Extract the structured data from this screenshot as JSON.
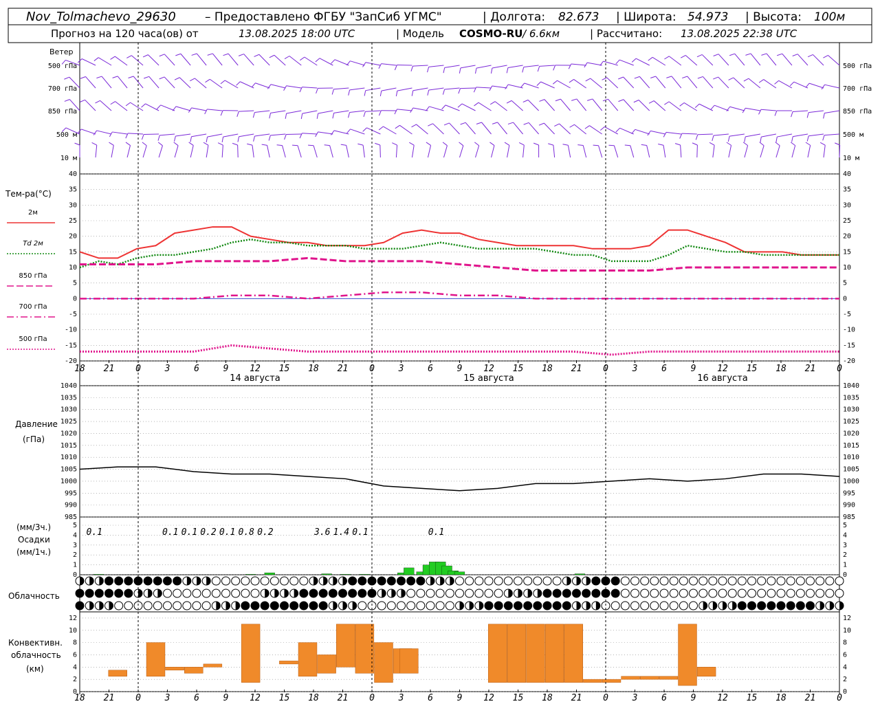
{
  "header": {
    "station": "Nov_Tolmachevo_29630",
    "provider": "– Предоставлено ФГБУ \"ЗапСиб УГМС\"",
    "lon_label": "| Долгота:",
    "lon_value": "82.673",
    "lat_label": "| Широта:",
    "lat_value": "54.973",
    "alt_label": "| Высота:",
    "alt_value": "100м",
    "forecast_label": "Прогноз на 120 часа(ов) от",
    "forecast_start": "13.08.2025 18:00 UTC",
    "model_label": "| Модель",
    "model_name": "COSMO-RU",
    "model_res": "/ 6.6км",
    "calc_label": "| Рассчитано:",
    "calc_time": "13.08.2025 22:38 UTC"
  },
  "wind_panel": {
    "title": "Ветер",
    "levels": [
      "500 гПа",
      "700 гПа",
      "850 гПа",
      "500 м",
      "10  м"
    ],
    "barb_color": "#7a28d8"
  },
  "temp_panel": {
    "title": "Тем-ра(°С)",
    "legend": [
      {
        "label": "2м",
        "color": "#ee3333",
        "style": "solid"
      },
      {
        "label": "Td  2м",
        "color": "#118811",
        "style": "dotted"
      },
      {
        "label": "850 гПа",
        "color": "#e0148c",
        "style": "dashed"
      },
      {
        "label": "700 гПа",
        "color": "#e0148c",
        "style": "dashdot"
      },
      {
        "label": "500 гПа",
        "color": "#e0148c",
        "style": "dotted"
      }
    ],
    "y_ticks": [
      "40",
      "35",
      "30",
      "25",
      "20",
      "15",
      "10",
      "5",
      "0",
      "-5",
      "-10",
      "-15",
      "-20"
    ]
  },
  "x_axis": {
    "hour_labels": [
      "18",
      "21",
      "0",
      "3",
      "6",
      "9",
      "12",
      "15",
      "18",
      "21",
      "0",
      "3",
      "6",
      "9",
      "12",
      "15",
      "18",
      "21",
      "0",
      "3",
      "6",
      "9",
      "12",
      "15",
      "18",
      "21",
      "0"
    ],
    "day_labels": [
      "14 августа",
      "15 августа",
      "16 августа"
    ]
  },
  "pressure_panel": {
    "title_line1": "Давление",
    "title_line2": "(гПа)",
    "y_ticks": [
      "1040",
      "1035",
      "1030",
      "1025",
      "1020",
      "1015",
      "1010",
      "1005",
      "1000",
      "995",
      "990",
      "985"
    ]
  },
  "precip_panel": {
    "label_3h": "(мм/3ч.)",
    "title": "Осадки",
    "label_1h": "(мм/1ч.)",
    "y_ticks": [
      "5",
      "4",
      "3",
      "2",
      "1",
      "0"
    ],
    "color": "#22cc22",
    "totals_3h": [
      {
        "hour": 0,
        "text": "0.1"
      },
      {
        "hour": 12,
        "text": "0.1"
      },
      {
        "hour": 15,
        "text": "0.1"
      },
      {
        "hour": 18,
        "text": "0.2"
      },
      {
        "hour": 21,
        "text": "0.1"
      },
      {
        "hour": 24,
        "text": "0.8"
      },
      {
        "hour": 27,
        "text": "0.2"
      },
      {
        "hour": 36,
        "text": "3.6"
      },
      {
        "hour": 39,
        "text": "1.4"
      },
      {
        "hour": 42,
        "text": "0.1"
      },
      {
        "hour": 54,
        "text": "0.1"
      }
    ]
  },
  "cloud_panel": {
    "title": "Облачность"
  },
  "conv_panel": {
    "title_line1": "Конвективн.",
    "title_line2": "облачность",
    "title_line3": "(км)",
    "y_ticks": [
      "12",
      "10",
      "8",
      "6",
      "4",
      "2",
      "0"
    ],
    "color": "#f08a2a"
  },
  "chart_data": [
    {
      "type": "line",
      "title": "Тем-ра(°С)",
      "x_unit": "hours from 13.08.2025 18:00 UTC",
      "ylim": [
        -20,
        40
      ],
      "series": [
        {
          "name": "2м",
          "x": [
            0,
            3,
            6,
            9,
            12,
            15,
            18,
            21,
            24,
            27,
            30,
            33,
            36,
            39,
            42,
            45,
            48,
            51,
            54,
            57,
            60,
            63,
            66,
            69,
            72,
            75,
            78,
            81,
            84,
            87,
            90,
            93,
            96,
            99,
            102,
            105,
            108,
            111,
            114,
            117,
            120
          ],
          "y": [
            15,
            13,
            13,
            16,
            17,
            21,
            22,
            23,
            23,
            20,
            19,
            18,
            18,
            17,
            17,
            17,
            18,
            21,
            22,
            21,
            21,
            19,
            18,
            17,
            17,
            17,
            17,
            16,
            16,
            16,
            17,
            22,
            22,
            20,
            18,
            15,
            15,
            15,
            14,
            14,
            14
          ]
        },
        {
          "name": "Td  2м",
          "x": [
            0,
            3,
            6,
            9,
            12,
            15,
            18,
            21,
            24,
            27,
            30,
            33,
            36,
            39,
            42,
            45,
            48,
            51,
            54,
            57,
            60,
            63,
            66,
            69,
            72,
            75,
            78,
            81,
            84,
            87,
            90,
            93,
            96,
            99,
            102,
            105,
            108,
            111,
            114,
            117,
            120
          ],
          "y": [
            10,
            12,
            11,
            13,
            14,
            14,
            15,
            16,
            18,
            19,
            18,
            18,
            17,
            17,
            17,
            16,
            16,
            16,
            17,
            18,
            17,
            16,
            16,
            16,
            16,
            15,
            14,
            14,
            12,
            12,
            12,
            14,
            17,
            16,
            15,
            15,
            14,
            14,
            14,
            14,
            14
          ]
        },
        {
          "name": "850 гПа",
          "x": [
            0,
            6,
            12,
            18,
            24,
            30,
            36,
            42,
            48,
            54,
            60,
            66,
            72,
            78,
            84,
            90,
            96,
            102,
            108,
            114,
            120
          ],
          "y": [
            11,
            11,
            11,
            12,
            12,
            12,
            13,
            12,
            12,
            12,
            11,
            10,
            9,
            9,
            9,
            9,
            10,
            10,
            10,
            10,
            10
          ]
        },
        {
          "name": "700 гПа",
          "x": [
            0,
            6,
            12,
            18,
            24,
            30,
            36,
            42,
            48,
            54,
            60,
            66,
            72,
            78,
            84,
            90,
            96,
            102,
            108,
            114,
            120
          ],
          "y": [
            0,
            0,
            0,
            0,
            1,
            1,
            0,
            1,
            2,
            2,
            1,
            1,
            0,
            0,
            0,
            0,
            0,
            0,
            0,
            0,
            0
          ]
        },
        {
          "name": "500 гПа",
          "x": [
            0,
            6,
            12,
            18,
            24,
            30,
            36,
            42,
            48,
            54,
            60,
            66,
            72,
            78,
            84,
            90,
            96,
            102,
            108,
            114,
            120
          ],
          "y": [
            -17,
            -17,
            -17,
            -17,
            -15,
            -16,
            -17,
            -17,
            -17,
            -17,
            -17,
            -17,
            -17,
            -17,
            -18,
            -17,
            -17,
            -17,
            -17,
            -17,
            -17
          ]
        }
      ]
    },
    {
      "type": "line",
      "title": "Давление (гПа)",
      "x_unit": "hours from 13.08.2025 18:00 UTC",
      "ylim": [
        985,
        1040
      ],
      "series": [
        {
          "name": "",
          "x": [
            0,
            6,
            12,
            18,
            24,
            30,
            36,
            42,
            48,
            54,
            60,
            66,
            72,
            78,
            84,
            90,
            96,
            102,
            108,
            114,
            120
          ],
          "y": [
            1005,
            1006,
            1006,
            1004,
            1003,
            1003,
            1002,
            1001,
            998,
            997,
            996,
            997,
            999,
            999,
            1000,
            1001,
            1000,
            1001,
            1003,
            1003,
            1002
          ]
        }
      ]
    },
    {
      "type": "bar",
      "title": "Осадки",
      "x_unit": "hours from 13.08.2025 18:00 UTC",
      "ylim": [
        0,
        5
      ],
      "series": [
        {
          "name": "",
          "x": [
            3,
            27,
            30,
            39,
            42,
            45,
            51,
            52,
            54,
            55,
            56,
            57,
            58,
            59,
            60,
            79
          ],
          "y": [
            0.05,
            0.05,
            0.2,
            0.1,
            0.05,
            0.05,
            0.2,
            0.7,
            0.3,
            1.0,
            1.3,
            1.3,
            0.9,
            0.4,
            0.3,
            0.1
          ]
        }
      ]
    },
    {
      "type": "bar",
      "title": "Конвективн. облачность (км)",
      "x_unit": "hours from 13.08.2025 18:00 UTC",
      "ylim": [
        0,
        13
      ],
      "series": [
        {
          "name": "top",
          "x": [
            6,
            12,
            15,
            18,
            21,
            27,
            33,
            36,
            39,
            42,
            45,
            48,
            51,
            52,
            66,
            69,
            72,
            75,
            78,
            81,
            84,
            87,
            90,
            93,
            96,
            99
          ],
          "y": [
            3.5,
            8,
            4,
            4,
            4.5,
            11,
            5,
            8,
            6,
            11,
            11,
            8,
            7,
            7,
            11,
            11,
            11,
            11,
            11,
            2,
            2,
            2.5,
            2.5,
            2.5,
            11,
            4
          ]
        },
        {
          "name": "base",
          "x": [
            6,
            12,
            15,
            18,
            21,
            27,
            33,
            36,
            39,
            42,
            45,
            48,
            51,
            52,
            66,
            69,
            72,
            75,
            78,
            81,
            84,
            87,
            90,
            93,
            96,
            99
          ],
          "y": [
            2.5,
            2.5,
            3.5,
            3,
            4,
            1.5,
            4.5,
            2.5,
            3,
            4,
            3,
            1.5,
            3,
            3,
            1.5,
            1.5,
            1.5,
            1.5,
            1.5,
            1.5,
            1.5,
            2,
            2,
            2,
            1,
            2.5
          ]
        }
      ]
    }
  ]
}
